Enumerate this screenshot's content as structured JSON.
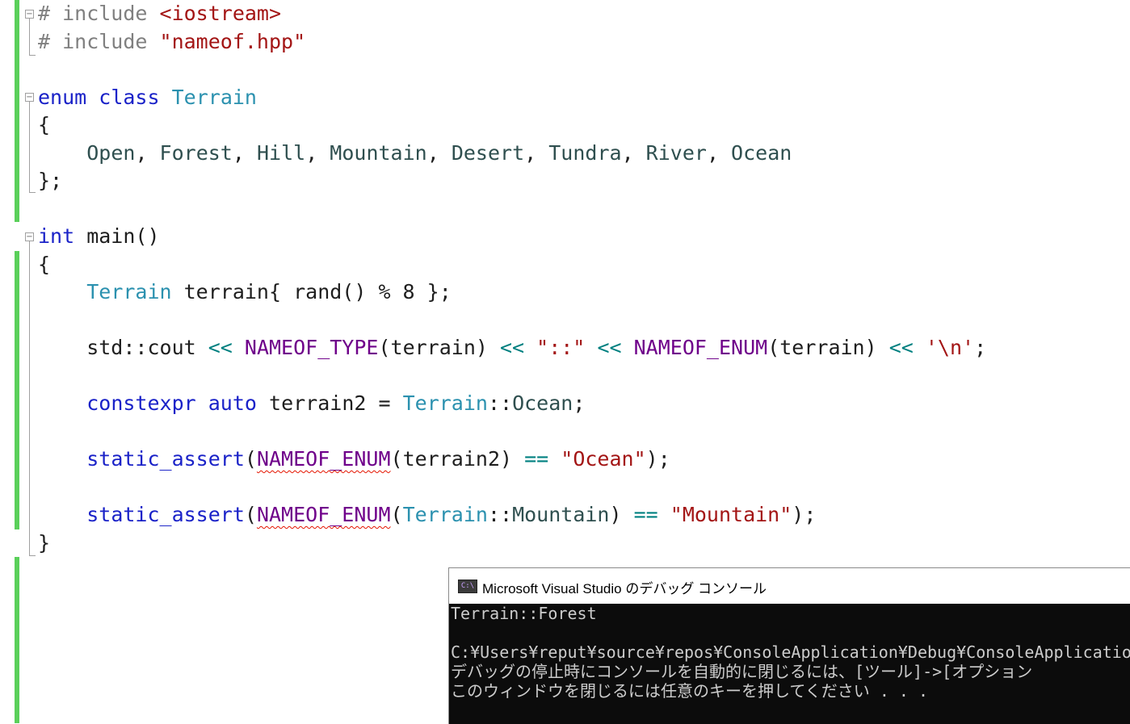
{
  "code": {
    "lines": [
      {
        "row": 0,
        "tokens": [
          [
            "pp",
            "# include "
          ],
          [
            "str",
            "<iostream>"
          ]
        ]
      },
      {
        "row": 1,
        "tokens": [
          [
            "pp",
            "# include "
          ],
          [
            "str",
            "\"nameof.hpp\""
          ]
        ]
      },
      {
        "row": 3,
        "tokens": [
          [
            "kw",
            "enum"
          ],
          [
            "t",
            " "
          ],
          [
            "kw",
            "class"
          ],
          [
            "t",
            " "
          ],
          [
            "ty",
            "Terrain"
          ]
        ]
      },
      {
        "row": 4,
        "tokens": [
          [
            "t",
            "{"
          ]
        ]
      },
      {
        "row": 5,
        "tokens": [
          [
            "t",
            "    "
          ],
          [
            "en",
            "Open"
          ],
          [
            "t",
            ", "
          ],
          [
            "en",
            "Forest"
          ],
          [
            "t",
            ", "
          ],
          [
            "en",
            "Hill"
          ],
          [
            "t",
            ", "
          ],
          [
            "en",
            "Mountain"
          ],
          [
            "t",
            ", "
          ],
          [
            "en",
            "Desert"
          ],
          [
            "t",
            ", "
          ],
          [
            "en",
            "Tundra"
          ],
          [
            "t",
            ", "
          ],
          [
            "en",
            "River"
          ],
          [
            "t",
            ", "
          ],
          [
            "en",
            "Ocean"
          ]
        ]
      },
      {
        "row": 6,
        "tokens": [
          [
            "t",
            "};"
          ]
        ]
      },
      {
        "row": 8,
        "tokens": [
          [
            "kw",
            "int"
          ],
          [
            "t",
            " main()"
          ]
        ]
      },
      {
        "row": 9,
        "tokens": [
          [
            "t",
            "{"
          ]
        ]
      },
      {
        "row": 10,
        "tokens": [
          [
            "t",
            "    "
          ],
          [
            "ty",
            "Terrain"
          ],
          [
            "t",
            " terrain{ rand() % 8 };"
          ]
        ]
      },
      {
        "row": 12,
        "tokens": [
          [
            "t",
            "    std::cout "
          ],
          [
            "op",
            "<<"
          ],
          [
            "t",
            " "
          ],
          [
            "mac",
            "NAMEOF_TYPE"
          ],
          [
            "t",
            "(terrain) "
          ],
          [
            "op",
            "<<"
          ],
          [
            "t",
            " "
          ],
          [
            "str",
            "\"::\""
          ],
          [
            "t",
            " "
          ],
          [
            "op",
            "<<"
          ],
          [
            "t",
            " "
          ],
          [
            "mac",
            "NAMEOF_ENUM"
          ],
          [
            "t",
            "(terrain) "
          ],
          [
            "op",
            "<<"
          ],
          [
            "t",
            " "
          ],
          [
            "str",
            "'\\n'"
          ],
          [
            "t",
            ";"
          ]
        ]
      },
      {
        "row": 14,
        "tokens": [
          [
            "t",
            "    "
          ],
          [
            "kw",
            "constexpr"
          ],
          [
            "t",
            " "
          ],
          [
            "kw",
            "auto"
          ],
          [
            "t",
            " terrain2 = "
          ],
          [
            "ty",
            "Terrain"
          ],
          [
            "t",
            "::"
          ],
          [
            "en",
            "Ocean"
          ],
          [
            "t",
            ";"
          ]
        ]
      },
      {
        "row": 16,
        "tokens": [
          [
            "t",
            "    "
          ],
          [
            "kw",
            "static_assert"
          ],
          [
            "t",
            "("
          ],
          [
            "mac squig",
            "NAMEOF_ENUM"
          ],
          [
            "t",
            "(terrain2) "
          ],
          [
            "op",
            "=="
          ],
          [
            "t",
            " "
          ],
          [
            "str",
            "\"Ocean\""
          ],
          [
            "t",
            ");"
          ]
        ]
      },
      {
        "row": 18,
        "tokens": [
          [
            "t",
            "    "
          ],
          [
            "kw",
            "static_assert"
          ],
          [
            "t",
            "("
          ],
          [
            "mac squig",
            "NAMEOF_ENUM"
          ],
          [
            "t",
            "("
          ],
          [
            "ty",
            "Terrain"
          ],
          [
            "t",
            "::"
          ],
          [
            "en",
            "Mountain"
          ],
          [
            "t",
            ") "
          ],
          [
            "op",
            "=="
          ],
          [
            "t",
            " "
          ],
          [
            "str",
            "\"Mountain\""
          ],
          [
            "t",
            ");"
          ]
        ]
      },
      {
        "row": 19,
        "tokens": [
          [
            "t",
            "}"
          ]
        ]
      }
    ]
  },
  "console": {
    "title": "Microsoft Visual Studio のデバッグ コンソール",
    "icon_label": "C:\\",
    "lines": [
      "Terrain::Forest",
      "",
      "C:¥Users¥reput¥source¥repos¥ConsoleApplication¥Debug¥ConsoleApplication",
      "デバッグの停止時にコンソールを自動的に閉じるには、[ツール]->[オプション",
      "このウィンドウを閉じるには任意のキーを押してください . . ."
    ]
  },
  "colors": {
    "keyword": "#1a22c8",
    "type": "#2b91af",
    "string": "#a31515",
    "macro": "#6f008a",
    "change_bar": "#5ad05a",
    "console_bg": "#0c0c0c"
  }
}
